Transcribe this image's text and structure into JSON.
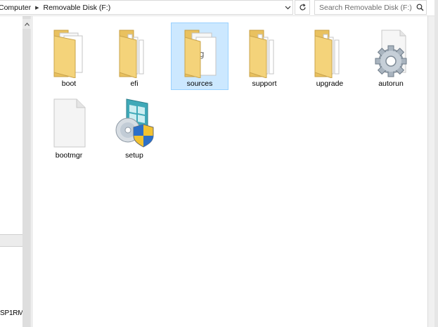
{
  "address_bar": {
    "breadcrumbs": [
      "Computer",
      "Removable Disk (F:)"
    ]
  },
  "search": {
    "placeholder": "Search Removable Disk (F:)"
  },
  "nav": {
    "visible_label": "SP1RM"
  },
  "items": [
    {
      "name": "boot",
      "type": "folder",
      "icon": "folder-icon"
    },
    {
      "name": "efi",
      "type": "folder",
      "icon": "folder-icon"
    },
    {
      "name": "sources",
      "type": "folder",
      "icon": "folder-icon",
      "selected": true
    },
    {
      "name": "support",
      "type": "folder",
      "icon": "folder-icon"
    },
    {
      "name": "upgrade",
      "type": "folder",
      "icon": "folder-icon"
    },
    {
      "name": "autorun",
      "type": "settings-file",
      "icon": "gear-file-icon"
    },
    {
      "name": "bootmgr",
      "type": "file",
      "icon": "blank-file-icon"
    },
    {
      "name": "setup",
      "type": "installer",
      "icon": "setup-installer-icon"
    }
  ],
  "colors": {
    "selection_bg": "#cce8ff",
    "selection_border": "#99d1ff",
    "folder_yellow": "#f4d37a"
  }
}
